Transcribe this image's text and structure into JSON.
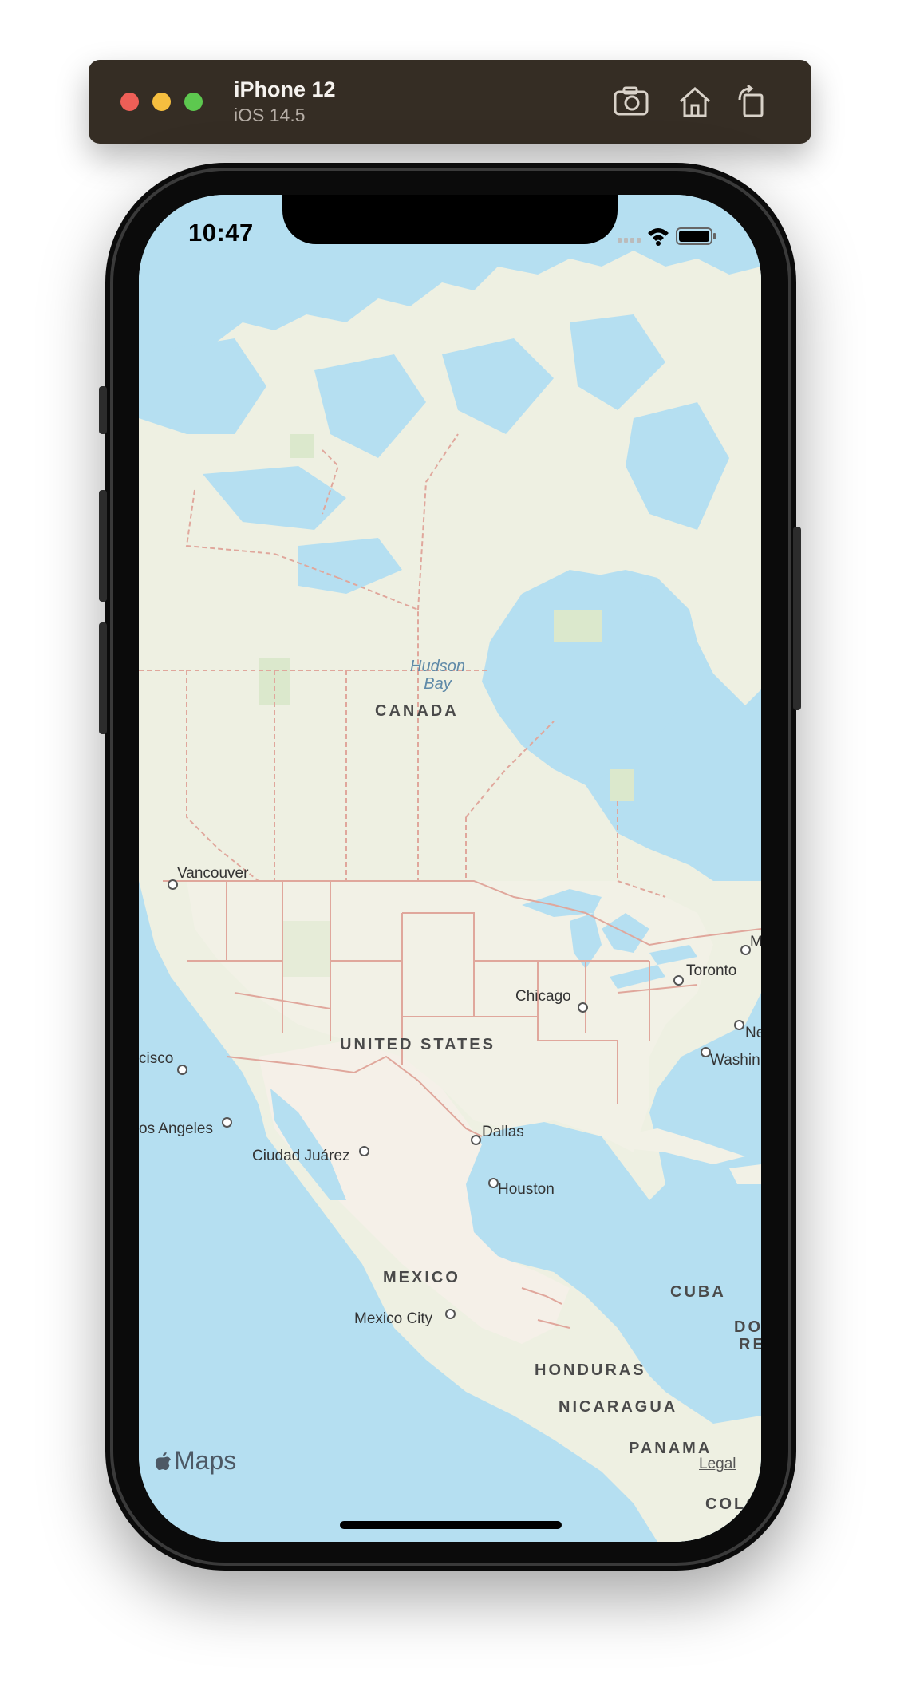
{
  "simulator": {
    "device_name": "iPhone 12",
    "os_version": "iOS 14.5",
    "toolbar_icons": [
      "screenshot-icon",
      "home-icon",
      "rotate-icon"
    ]
  },
  "status_bar": {
    "time": "10:47",
    "icons": [
      "cellular-signal-icon",
      "wifi-icon",
      "battery-icon"
    ]
  },
  "map": {
    "labels": {
      "canada": "CANADA",
      "united_states": "UNITED STATES",
      "mexico": "MEXICO",
      "cuba": "CUBA",
      "honduras": "HONDURAS",
      "nicaragua": "NICARAGUA",
      "panama": "PANAMA",
      "colombia_partial": "COLO",
      "dominican_partial_1": "DO",
      "dominican_partial_2": "RE",
      "hudson_bay_1": "Hudson",
      "hudson_bay_2": "Bay"
    },
    "cities": {
      "vancouver": "Vancouver",
      "san_francisco_partial": "cisco",
      "los_angeles_partial": "os Angeles",
      "ciudad_juarez": "Ciudad Juárez",
      "dallas": "Dallas",
      "houston": "Houston",
      "chicago": "Chicago",
      "toronto": "Toronto",
      "montreal_partial": "M",
      "new_york_partial": "Ne",
      "washington_partial": "Washin",
      "mexico_city": "Mexico City"
    },
    "colors": {
      "water": "#b5dff1",
      "land": "#eef0e2",
      "border": "#e0a79c"
    }
  },
  "attribution": {
    "logo_text": "Maps",
    "legal_link": "Legal"
  }
}
